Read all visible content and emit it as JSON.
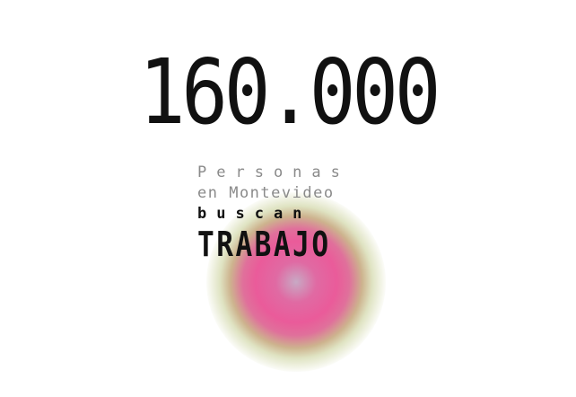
{
  "headline": {
    "number": "160.000"
  },
  "caption": {
    "line1": "Personas",
    "line2": "en Montevideo",
    "line3": "buscan",
    "line4": "TRABAJO"
  },
  "colors": {
    "background": "#ffffff",
    "number": "#111111",
    "muted_text": "#8a8a8a",
    "glow_core": "#ea5b9a",
    "glow_outer": "#dfe3c2"
  }
}
